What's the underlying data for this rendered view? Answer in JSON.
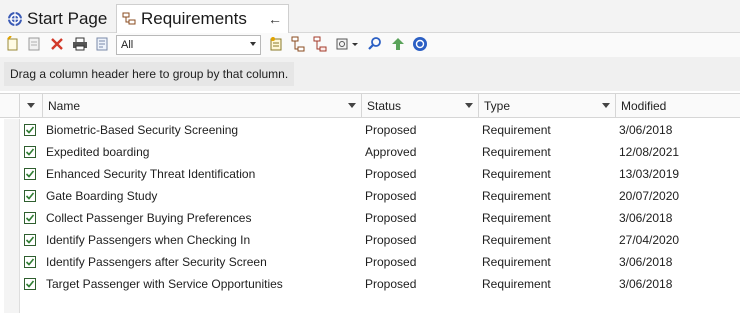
{
  "tabs": [
    {
      "label": "Start Page",
      "icon": "start-page-icon"
    },
    {
      "label": "Requirements",
      "icon": "requirements-diagram-icon",
      "active": true
    }
  ],
  "toolbar": {
    "filter_value": "All",
    "icons": [
      "new-element-icon",
      "properties-icon",
      "delete-icon",
      "print-icon",
      "document-icon",
      "requirement-icon",
      "hierarchy-icon",
      "hierarchy-alt-icon",
      "options-icon",
      "find-icon",
      "move-up-icon",
      "help-icon"
    ]
  },
  "group_hint": "Drag a column header here to group by that column.",
  "columns": [
    "Name",
    "Status",
    "Type",
    "Modified"
  ],
  "rows": [
    {
      "name": "Biometric-Based Security Screening",
      "status": "Proposed",
      "type": "Requirement",
      "modified": "3/06/2018"
    },
    {
      "name": "Expedited boarding",
      "status": "Approved",
      "type": "Requirement",
      "modified": "12/08/2021"
    },
    {
      "name": "Enhanced Security Threat Identification",
      "status": "Proposed",
      "type": "Requirement",
      "modified": "13/03/2019"
    },
    {
      "name": "Gate Boarding Study",
      "status": "Proposed",
      "type": "Requirement",
      "modified": "20/07/2020"
    },
    {
      "name": "Collect Passenger Buying Preferences",
      "status": "Proposed",
      "type": "Requirement",
      "modified": "3/06/2018"
    },
    {
      "name": "Identify Passengers when Checking In",
      "status": "Proposed",
      "type": "Requirement",
      "modified": "27/04/2020"
    },
    {
      "name": "Identify Passengers after Security Screen",
      "status": "Proposed",
      "type": "Requirement",
      "modified": "3/06/2018"
    },
    {
      "name": "Target Passenger with Service Opportunities",
      "status": "Proposed",
      "type": "Requirement",
      "modified": "3/06/2018"
    }
  ],
  "colors": {
    "accent": "#2f7d32",
    "tab_icon": "#3b5bb5",
    "delete": "#d23a2a",
    "help": "#2b5fc4"
  }
}
